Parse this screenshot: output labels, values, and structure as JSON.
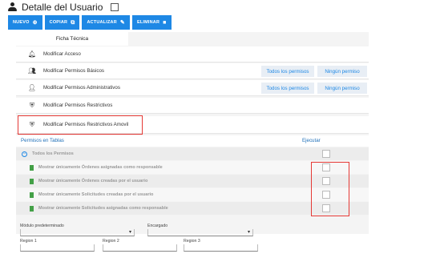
{
  "header": {
    "title": "Detalle del Usuario"
  },
  "toolbar": {
    "nuevo": {
      "label": "NUEVO",
      "icon": "plus-circle-icon"
    },
    "copiar": {
      "label": "COPIAR",
      "icon": "copy-icon"
    },
    "actualizar": {
      "label": "ACTUALIZAR",
      "icon": "pencil-icon"
    },
    "eliminar": {
      "label": "ELIMINAR",
      "icon": "trash-icon"
    }
  },
  "tab": {
    "label": "Ficha Técnica"
  },
  "permissions": [
    {
      "label": "Modificar Acceso",
      "icon": "bell-icon"
    },
    {
      "label": "Modificar Permisos Básicos",
      "icon": "group-icon"
    },
    {
      "label": "Modificar Permisos Administrativos",
      "icon": "person-icon"
    },
    {
      "label": "Modificar Permisos Restrictivos",
      "icon": "shield-icon"
    },
    {
      "label": "Modificar Permisos Restrictivos Amovil",
      "icon": "shield-icon"
    }
  ],
  "perm_buttons": {
    "all": "Todos los permisos",
    "none": "Ningún permiso"
  },
  "tables_section": {
    "title": "Permisos en Tablas",
    "exec_header": "Ejecutar",
    "root": "Todos los Permisos",
    "items": [
      "Mostrar únicamente Órdenes asignadas como responsable",
      "Mostrar únicamente Órdenes creadas por el usuario",
      "Mostrar únicamente Solicitudes creadas por el usuario",
      "Mostrar únicamente Solicitudes asignadas como responsable"
    ]
  },
  "filters": {
    "modulo": "Módulo predeterminado",
    "encargado": "Encargado",
    "region1": "Region 1",
    "region2": "Region 2",
    "region3": "Region 3"
  },
  "colors": {
    "accent": "#1e88e5",
    "highlight": "#e53935",
    "doc": "#43a047"
  }
}
